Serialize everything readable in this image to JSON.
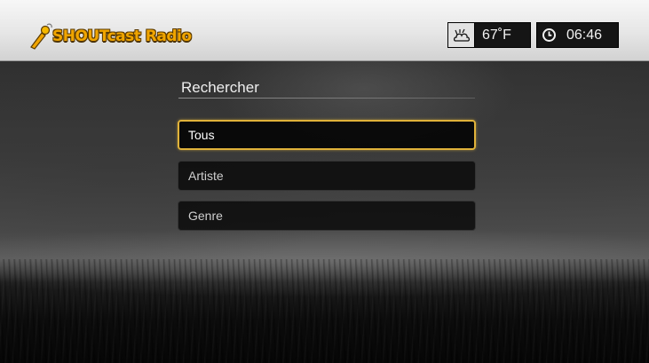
{
  "header": {
    "app_title": "SHOUTcast Radio",
    "weather": {
      "icon": "weather-icon",
      "temperature": "67˚F"
    },
    "clock": {
      "icon": "clock-icon",
      "time": "06:46"
    }
  },
  "menu": {
    "title": "Rechercher",
    "items": [
      {
        "label": "Tous",
        "selected": true
      },
      {
        "label": "Artiste",
        "selected": false
      },
      {
        "label": "Genre",
        "selected": false
      }
    ]
  },
  "colors": {
    "accent": "#e0b23a",
    "logo": "#f0a500",
    "header_bg": "#e9e9e9",
    "status_bg": "#151515"
  }
}
